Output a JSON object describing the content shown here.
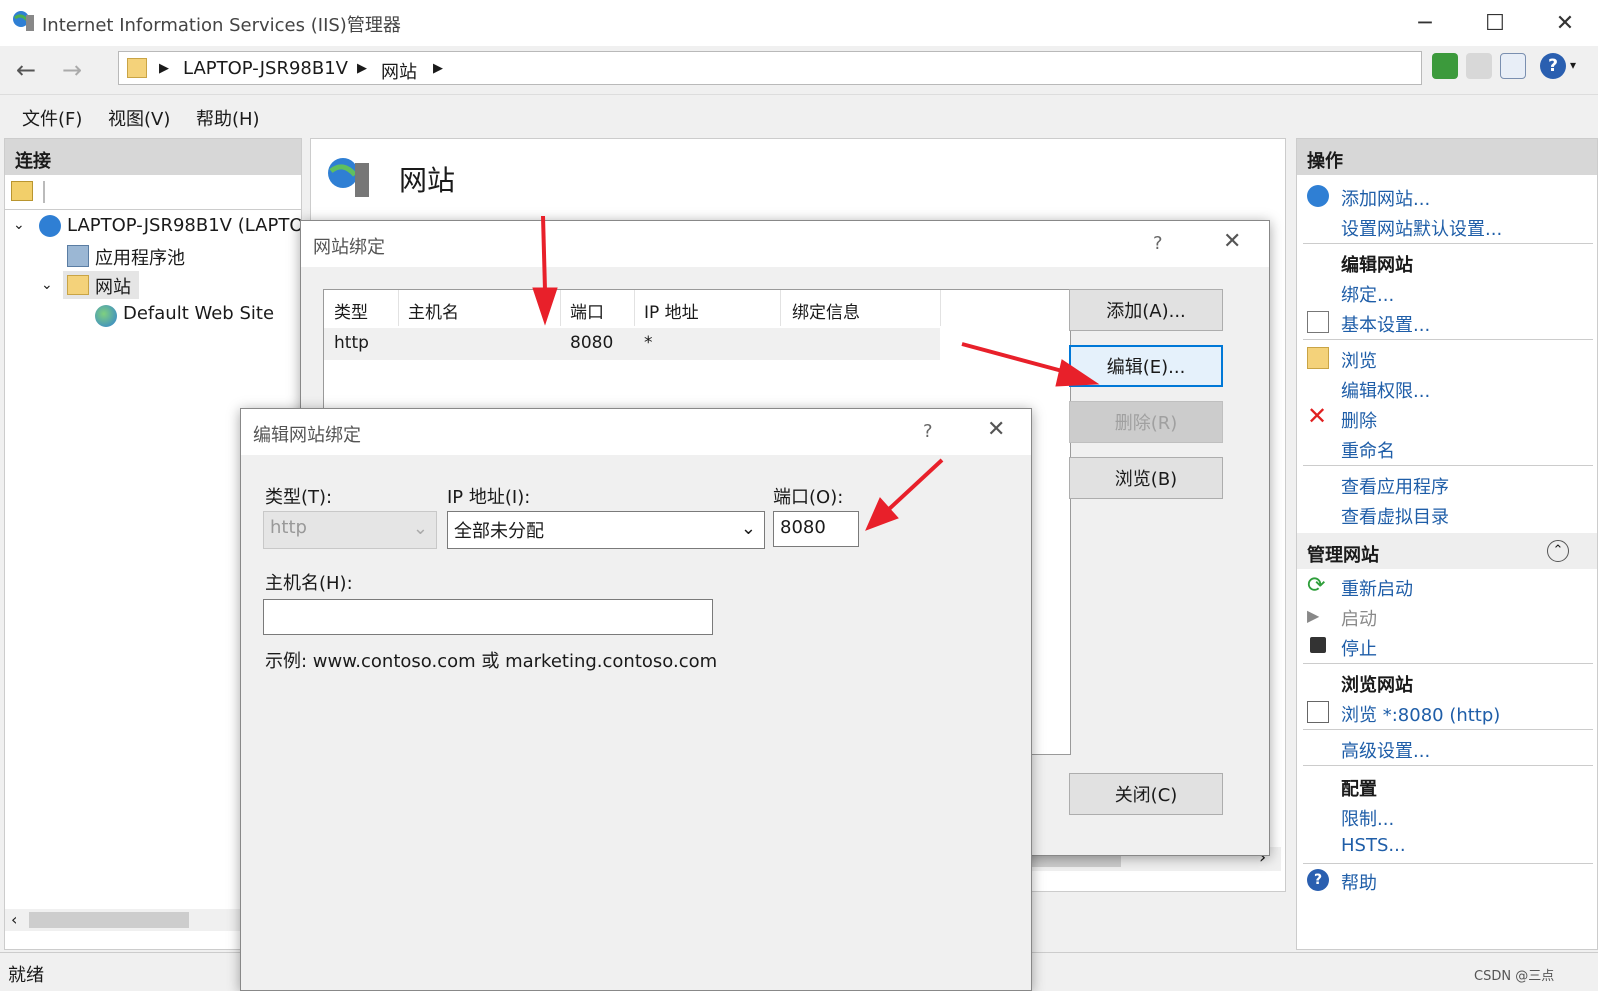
{
  "window": {
    "title": "Internet Information Services (IIS)管理器"
  },
  "address": {
    "crumbs": [
      "LAPTOP-JSR98B1V",
      "网站"
    ]
  },
  "menu": {
    "file": "文件(F)",
    "view": "视图(V)",
    "help": "帮助(H)"
  },
  "connections": {
    "header": "连接",
    "tree": {
      "server": "LAPTOP-JSR98B1V (LAPTO",
      "app_pools": "应用程序池",
      "sites": "网站",
      "default_site": "Default Web Site"
    }
  },
  "main": {
    "title": "网站"
  },
  "actions": {
    "header": "操作",
    "add_site": "添加网站...",
    "site_defaults": "设置网站默认设置...",
    "edit_site_hdr": "编辑网站",
    "bindings": "绑定...",
    "basic_settings": "基本设置...",
    "explore": "浏览",
    "edit_permissions": "编辑权限...",
    "remove": "删除",
    "rename": "重命名",
    "view_apps": "查看应用程序",
    "view_vdirs": "查看虚拟目录",
    "manage_site_hdr": "管理网站",
    "restart": "重新启动",
    "start": "启动",
    "stop": "停止",
    "browse_site_hdr": "浏览网站",
    "browse_8080": "浏览 *:8080 (http)",
    "advanced": "高级设置...",
    "config_hdr": "配置",
    "limits": "限制...",
    "hsts": "HSTS...",
    "help": "帮助"
  },
  "status": {
    "text": "就绪",
    "watermark": "CSDN @三点"
  },
  "bindings_dialog": {
    "title": "网站绑定",
    "help": "?",
    "columns": [
      "类型",
      "主机名",
      "端口",
      "IP 地址",
      "绑定信息"
    ],
    "rows": [
      {
        "type": "http",
        "host": "",
        "port": "8080",
        "ip": "*",
        "info": ""
      }
    ],
    "buttons": {
      "add": "添加(A)...",
      "edit": "编辑(E)...",
      "remove": "删除(R)",
      "browse": "浏览(B)",
      "close": "关闭(C)"
    }
  },
  "edit_dialog": {
    "title": "编辑网站绑定",
    "help": "?",
    "type_label": "类型(T):",
    "type_value": "http",
    "ip_label": "IP 地址(I):",
    "ip_value": "全部未分配",
    "port_label": "端口(O):",
    "port_value": "8080",
    "host_label": "主机名(H):",
    "host_value": "",
    "example": "示例: www.contoso.com 或 marketing.contoso.com"
  }
}
